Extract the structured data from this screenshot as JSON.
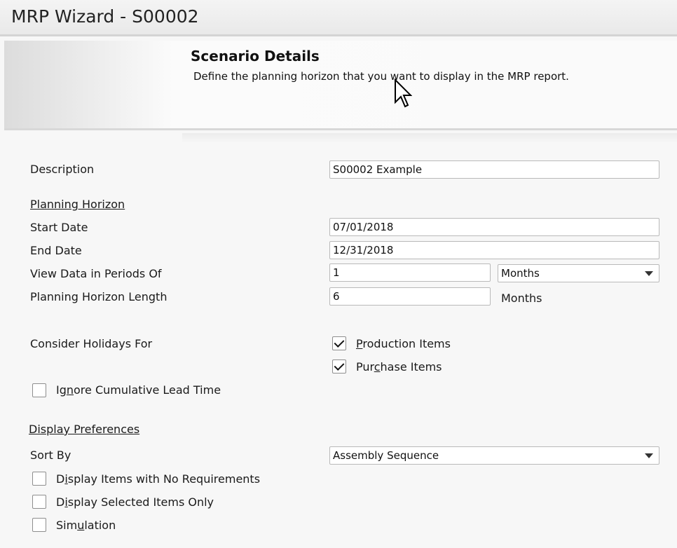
{
  "window": {
    "title": "MRP Wizard - S00002"
  },
  "header": {
    "title": "Scenario Details",
    "subtitle": "Define the planning horizon that you want to display in the MRP report."
  },
  "form": {
    "description": {
      "label": "Description",
      "value": "S00002 Example"
    },
    "planning_horizon_section": "Planning Horizon",
    "start_date": {
      "label": "Start Date",
      "value": "07/01/2018"
    },
    "end_date": {
      "label": "End Date",
      "value": "12/31/2018"
    },
    "view_periods": {
      "label": "View Data in Periods Of",
      "value": "1",
      "unit": "Months"
    },
    "horizon_length": {
      "label": "Planning Horizon Length",
      "value": "6",
      "unit": "Months"
    },
    "holidays": {
      "label": "Consider Holidays For",
      "production": {
        "pre": "",
        "key": "P",
        "post": "roduction Items",
        "checked": true
      },
      "purchase": {
        "pre": "Pur",
        "key": "c",
        "post": "hase Items",
        "checked": true
      }
    },
    "ignore_lead_time": {
      "pre": "Ig",
      "key": "n",
      "post": "ore Cumulative Lead Time",
      "checked": false
    },
    "display_section": "Display Preferences",
    "sort_by": {
      "label": "Sort By",
      "value": "Assembly Sequence"
    },
    "no_requirements": {
      "pre": "D",
      "key": "i",
      "post": "splay Items with No Requirements",
      "checked": false
    },
    "selected_only": {
      "pre": "D",
      "key": "i",
      "post": "splay Selected Items Only",
      "checked": false
    },
    "simulation": {
      "pre": "Sim",
      "key": "u",
      "post": "lation",
      "checked": false
    }
  }
}
